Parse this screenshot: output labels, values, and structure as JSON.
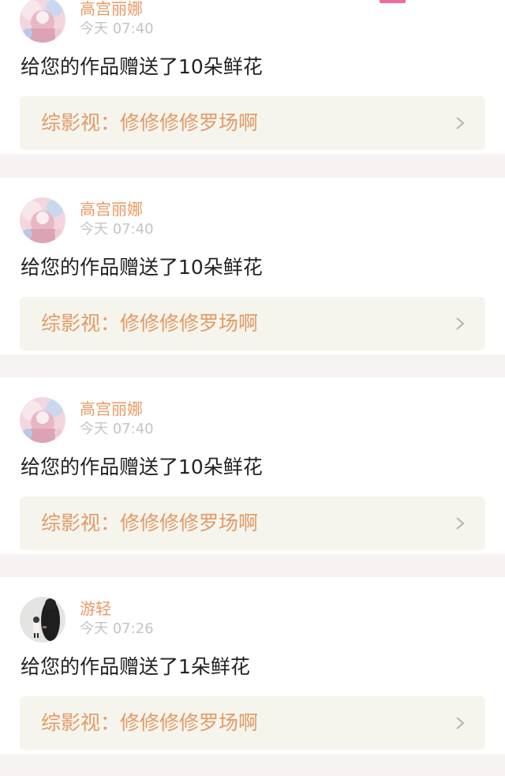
{
  "colors": {
    "accent": "#e99a63",
    "time": "#c4c4c4",
    "text": "#222222",
    "link_bg": "#f5f5ee",
    "separator": "#f7f3f3",
    "badge": "#f06aa0"
  },
  "feed": {
    "items": [
      {
        "avatar_icon": "pink-girl-avatar-icon",
        "user": "高宫丽娜",
        "time": "今天 07:40",
        "message": "给您的作品赠送了10朵鲜花",
        "work_label": "综影视：修修修修罗场啊",
        "chevron_icon": "chevron-right-icon"
      },
      {
        "avatar_icon": "pink-girl-avatar-icon",
        "user": "高宫丽娜",
        "time": "今天 07:40",
        "message": "给您的作品赠送了10朵鲜花",
        "work_label": "综影视：修修修修罗场啊",
        "chevron_icon": "chevron-right-icon"
      },
      {
        "avatar_icon": "pink-girl-avatar-icon",
        "user": "高宫丽娜",
        "time": "今天 07:40",
        "message": "给您的作品赠送了10朵鲜花",
        "work_label": "综影视：修修修修罗场啊",
        "chevron_icon": "chevron-right-icon"
      },
      {
        "avatar_icon": "dark-silhouette-avatar-icon",
        "user": "游轻",
        "time": "今天 07:26",
        "message": "给您的作品赠送了1朵鲜花",
        "work_label": "综影视：修修修修罗场啊",
        "chevron_icon": "chevron-right-icon"
      }
    ]
  }
}
